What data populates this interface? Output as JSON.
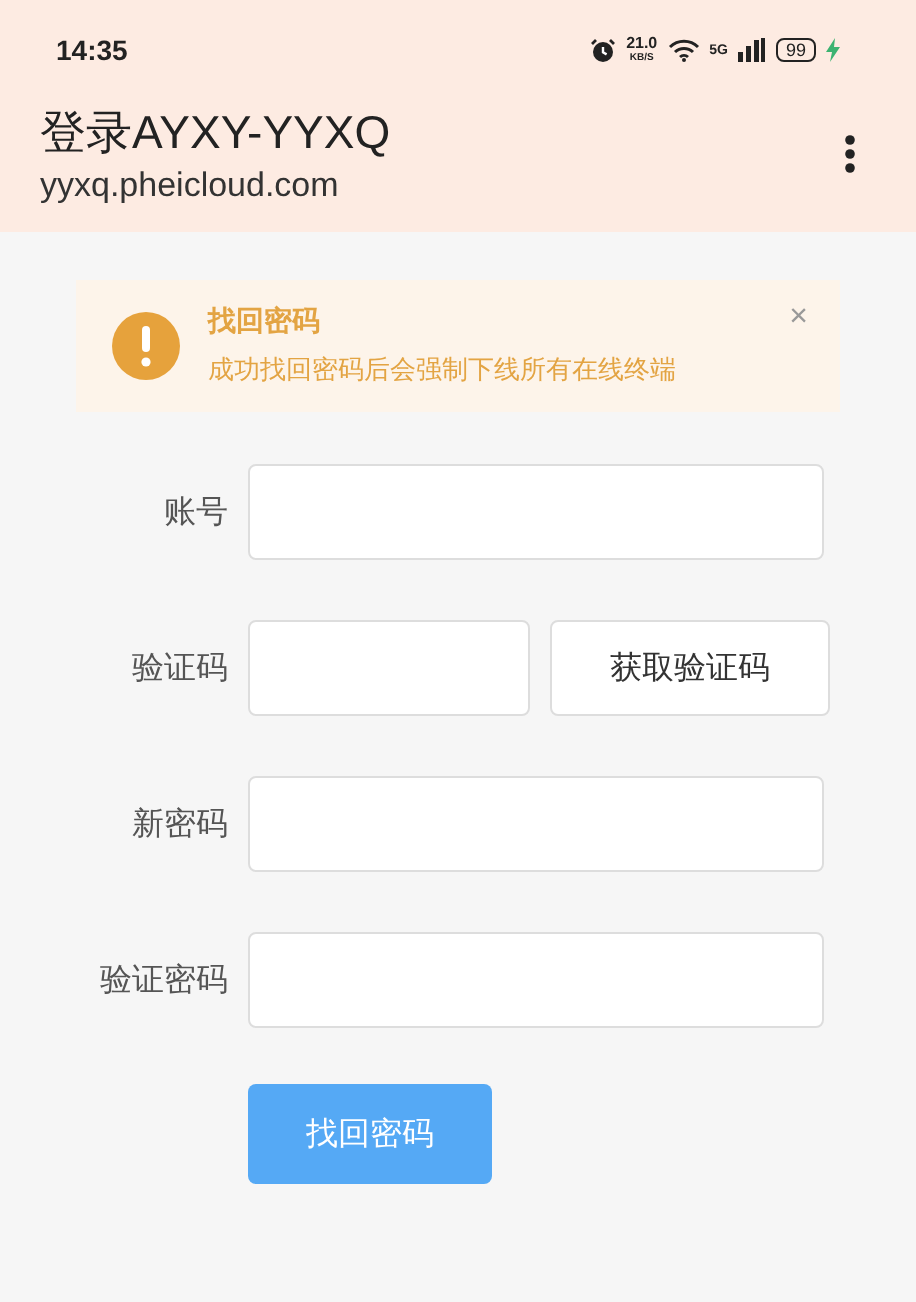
{
  "status_bar": {
    "time": "14:35",
    "speed": "21.0",
    "speed_unit": "KB/S",
    "network": "5G",
    "battery": "99"
  },
  "header": {
    "title": "登录AYXY-YYXQ",
    "url": "yyxq.pheicloud.com"
  },
  "alert": {
    "title": "找回密码",
    "message": "成功找回密码后会强制下线所有在线终端",
    "close": "×"
  },
  "form": {
    "fields": [
      {
        "label": "账号",
        "kind": "text"
      },
      {
        "label": "验证码",
        "kind": "code",
        "button": "获取验证码"
      },
      {
        "label": "新密码",
        "kind": "text"
      },
      {
        "label": "验证密码",
        "kind": "text"
      }
    ],
    "submit": "找回密码"
  }
}
